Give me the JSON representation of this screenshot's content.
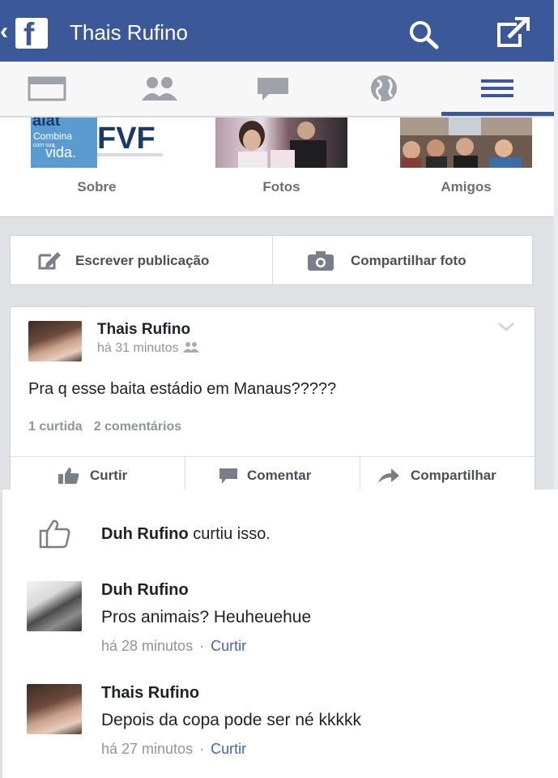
{
  "header": {
    "title": "Thais Rufino",
    "back_glyph": "‹",
    "logo_glyph": "f",
    "icons": [
      "facebook-logo-icon",
      "search-icon",
      "share-icon"
    ],
    "bar_color": "#3b5998"
  },
  "nav": {
    "icons": [
      "timeline-icon",
      "friends-icon",
      "messages-icon",
      "globe-icon",
      "menu-icon"
    ],
    "active": "menu-icon"
  },
  "strip": {
    "about_logo_top": "aiat",
    "about_logo_line1": "Combina",
    "about_logo_line2": "com sua",
    "about_logo_line3": "vida.",
    "about_logo_brand": "FVF",
    "items": [
      {
        "label": "Sobre"
      },
      {
        "label": "Fotos"
      },
      {
        "label": "Amigos"
      }
    ]
  },
  "composer": {
    "write_label": "Escrever publicação",
    "photo_label": "Compartilhar foto"
  },
  "post": {
    "author": "Thais Rufino",
    "time": "há 31 minutos",
    "text": "Pra q esse baita estádio em Manaus?????",
    "likes": "1 curtida",
    "comments": "2 comentários",
    "actions": {
      "like": "Curtir",
      "comment": "Comentar",
      "share": "Compartilhar"
    }
  },
  "likes_line": {
    "name": "Duh Rufino",
    "rest": " curtiu isso."
  },
  "comments": [
    {
      "author": "Duh Rufino",
      "text": "Pros animais? Heuheuehue",
      "time": "há 28 minutos",
      "dot": "·",
      "like": "Curtir"
    },
    {
      "author": "Thais Rufino",
      "text": "Depois da copa pode ser né kkkkk",
      "time": "há 27 minutos",
      "dot": "·",
      "like": "Curtir"
    }
  ]
}
